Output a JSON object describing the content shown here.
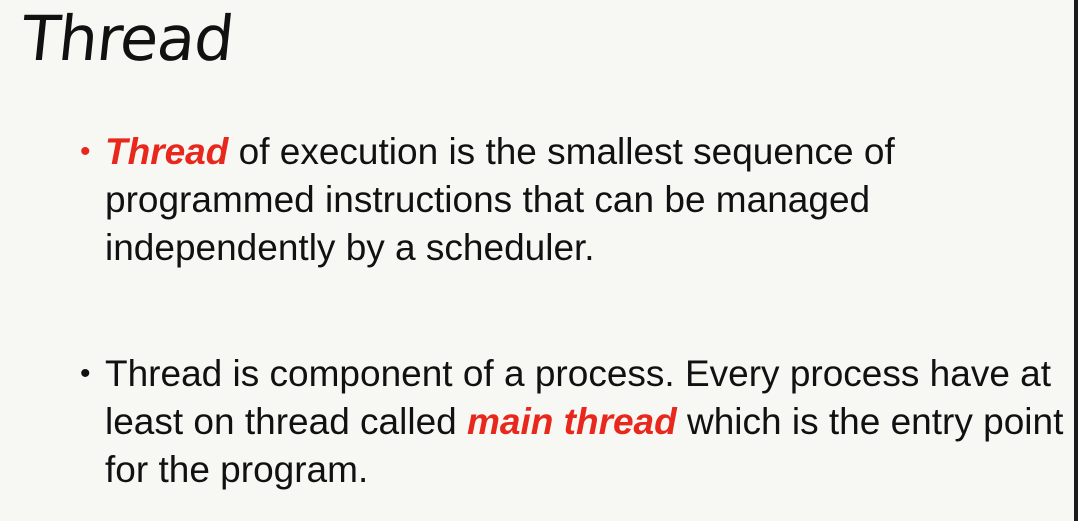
{
  "slide": {
    "title": "Thread",
    "bullets": [
      {
        "highlight": "Thread",
        "text": " of execution is the smallest sequence of programmed instructions that can be managed independently by a scheduler."
      },
      {
        "text_before": "Thread is component of a process. Every process have at least on thread called ",
        "highlight": "main thread",
        "text_after": " which is the entry point for the program."
      }
    ]
  },
  "colors": {
    "background": "#f7f7f3",
    "accent": "#e8271d",
    "text": "#111111"
  }
}
